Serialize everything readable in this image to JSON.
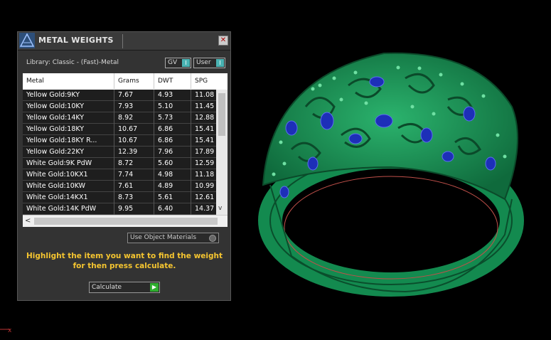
{
  "panel": {
    "title": "METAL WEIGHTS",
    "close_glyph": "✕",
    "library_label": "Library: Classic - (Fast)-Metal",
    "toggles": [
      {
        "label": "GV",
        "box": "I"
      },
      {
        "label": "User",
        "box": "I"
      }
    ],
    "columns": [
      "Metal",
      "Grams",
      "DWT",
      "SPG"
    ],
    "rows": [
      {
        "metal": "Yellow Gold:9KY",
        "grams": "7.67",
        "dwt": "4.93",
        "spg": "11.08"
      },
      {
        "metal": "Yellow Gold:10KY",
        "grams": "7.93",
        "dwt": "5.10",
        "spg": "11.45"
      },
      {
        "metal": "Yellow Gold:14KY",
        "grams": "8.92",
        "dwt": "5.73",
        "spg": "12.88"
      },
      {
        "metal": "Yellow Gold:18KY",
        "grams": "10.67",
        "dwt": "6.86",
        "spg": "15.41"
      },
      {
        "metal": "Yellow Gold:18KY R...",
        "grams": "10.67",
        "dwt": "6.86",
        "spg": "15.41"
      },
      {
        "metal": "Yellow Gold:22KY",
        "grams": "12.39",
        "dwt": "7.96",
        "spg": "17.89"
      },
      {
        "metal": "White Gold:9K PdW",
        "grams": "8.72",
        "dwt": "5.60",
        "spg": "12.59"
      },
      {
        "metal": "White Gold:10KX1",
        "grams": "7.74",
        "dwt": "4.98",
        "spg": "11.18"
      },
      {
        "metal": "White Gold:10KW",
        "grams": "7.61",
        "dwt": "4.89",
        "spg": "10.99"
      },
      {
        "metal": "White Gold:14KX1",
        "grams": "8.73",
        "dwt": "5.61",
        "spg": "12.61"
      },
      {
        "metal": "White Gold:14K PdW",
        "grams": "9.95",
        "dwt": "6.40",
        "spg": "14.37"
      }
    ],
    "use_object_materials": "Use Object Materials",
    "help_text": "Highlight the item you want to find the weight for then press calculate.",
    "calculate": {
      "label": "Calculate",
      "go": "▶"
    },
    "scroll_down": "v",
    "scroll_left": "<"
  },
  "colors": {
    "ring_metal": "#1f9a5c",
    "ring_metal_dark": "#0f5e37",
    "gem": "#1d2fb8",
    "help_text": "#f5c530"
  },
  "icons": [
    "app-logo-icon",
    "close-icon",
    "calculate-arrow-icon",
    "axis-icon"
  ]
}
